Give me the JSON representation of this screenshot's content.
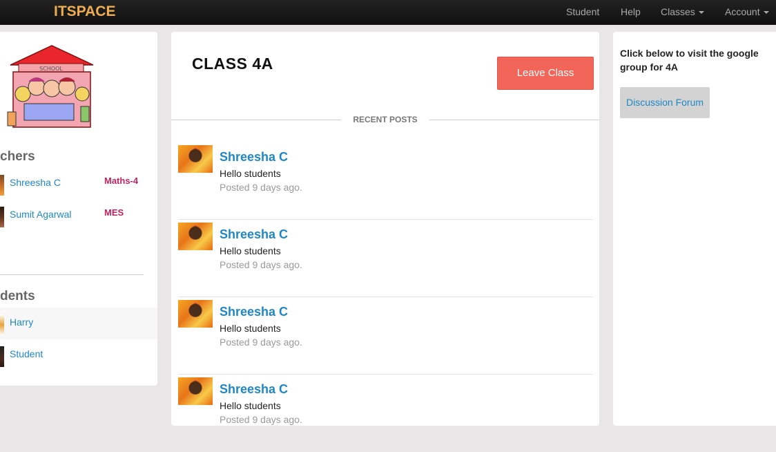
{
  "navbar": {
    "brand": "ITSPACE",
    "items": [
      {
        "label": "Student"
      },
      {
        "label": "Help"
      },
      {
        "label": "Classes"
      },
      {
        "label": "Account"
      }
    ]
  },
  "sidebar": {
    "logo_icon": "school-building-icon",
    "logo_text": "SCHOOL",
    "teachers_heading": "chers",
    "teachers": [
      {
        "name": "Shreesha C",
        "subject": "Maths-4"
      },
      {
        "name": "Sumit Agarwal",
        "subject": "MES"
      }
    ],
    "students_heading": "dents",
    "students": [
      {
        "name": "Harry"
      },
      {
        "name": "Student"
      }
    ]
  },
  "main": {
    "class_title": "CLASS 4A",
    "leave_button": "Leave Class",
    "recent_posts_label": "RECENT POSTS",
    "posts": [
      {
        "author": "Shreesha C",
        "text": "Hello students",
        "time": "Posted 9 days ago."
      },
      {
        "author": "Shreesha C",
        "text": "Hello students",
        "time": "Posted 9 days ago."
      },
      {
        "author": "Shreesha C",
        "text": "Hello students",
        "time": "Posted 9 days ago."
      },
      {
        "author": "Shreesha C",
        "text": "Hello students",
        "time": "Posted 9 days ago."
      }
    ]
  },
  "right_panel": {
    "heading": "Click below to visit the google group for 4A",
    "forum_button": "Discussion Forum"
  },
  "colors": {
    "brand": "#f0ad4e",
    "link": "#1e88c7",
    "subject": "#c0245e",
    "leave_button": "#f2665a"
  }
}
